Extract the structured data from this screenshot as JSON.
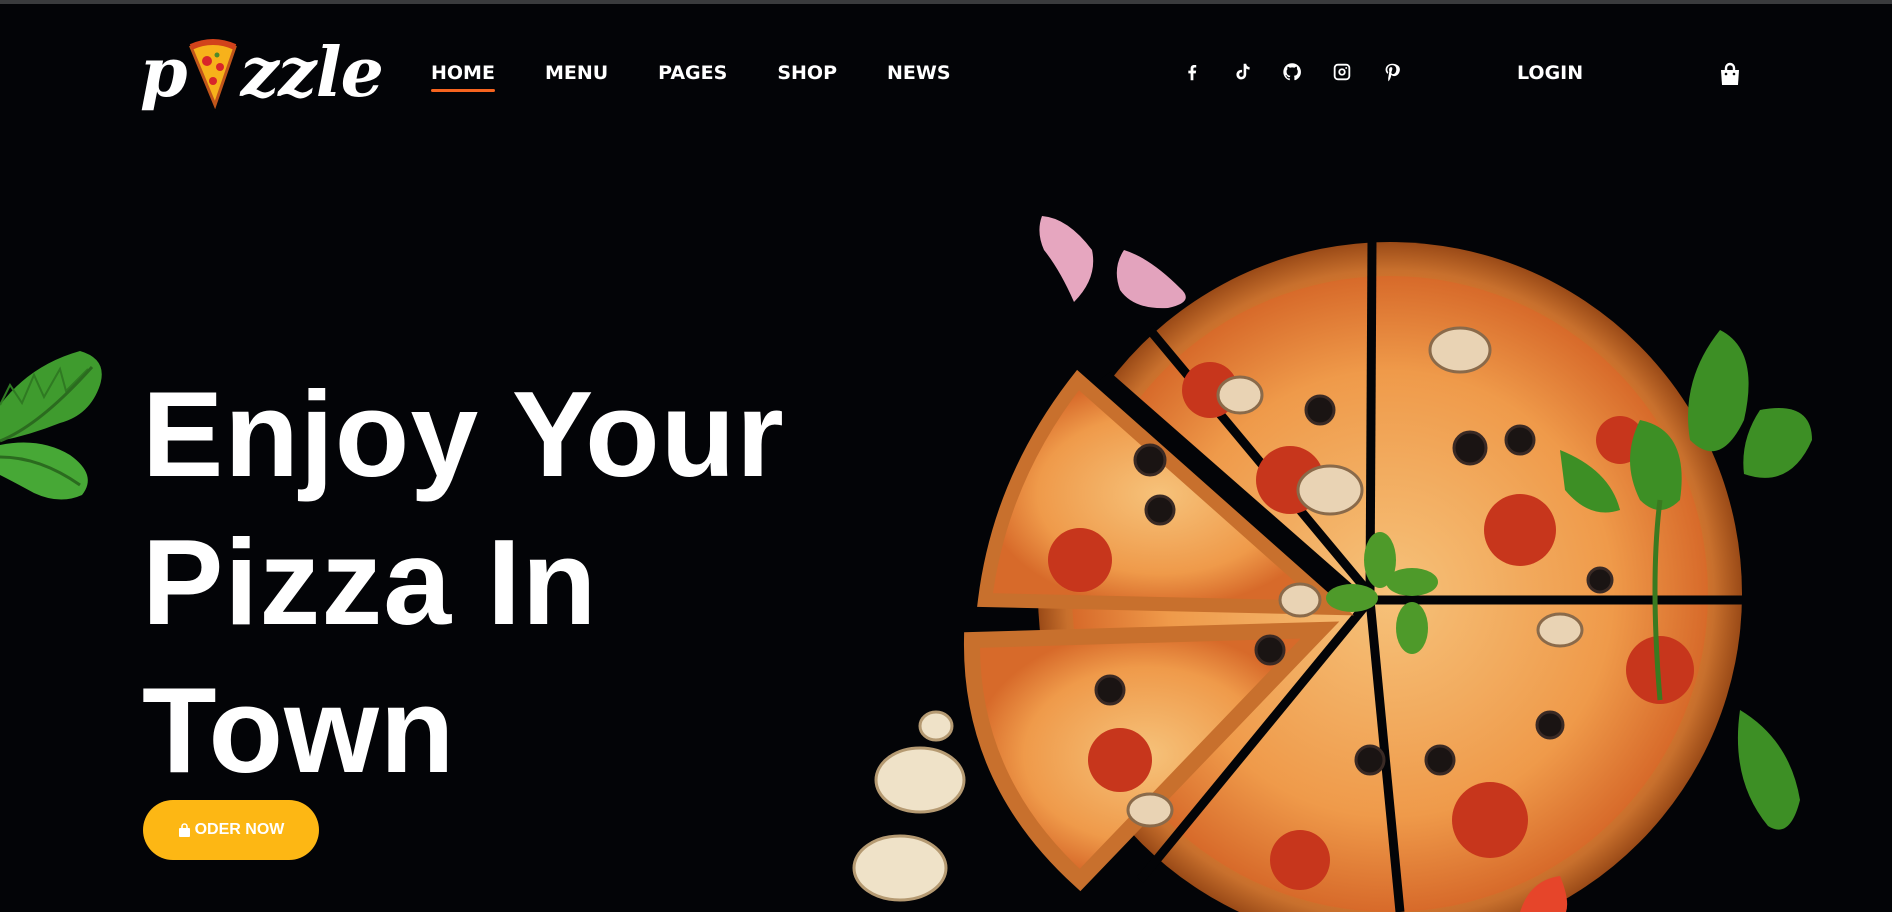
{
  "brand": {
    "logo_text_left": "p",
    "logo_text_right": "zzle"
  },
  "nav": {
    "items": [
      {
        "label": "HOME",
        "active": true
      },
      {
        "label": "MENU",
        "active": false
      },
      {
        "label": "PAGES",
        "active": false
      },
      {
        "label": "SHOP",
        "active": false
      },
      {
        "label": "NEWS",
        "active": false
      }
    ],
    "accent": "#f6641f"
  },
  "socials": [
    "facebook-icon",
    "tiktok-icon",
    "github-icon",
    "instagram-icon",
    "pinterest-icon"
  ],
  "header": {
    "login_label": "LOGIN",
    "cart_icon": "shopping-bag-icon"
  },
  "hero": {
    "title_lines": [
      "Enjoy Your",
      "Pizza In",
      "Town"
    ],
    "cta_label": "ODER NOW",
    "cta_icon": "shopping-bag-icon",
    "cta_color": "#fdb714"
  },
  "colors": {
    "background": "#030407",
    "text": "#ffffff"
  }
}
